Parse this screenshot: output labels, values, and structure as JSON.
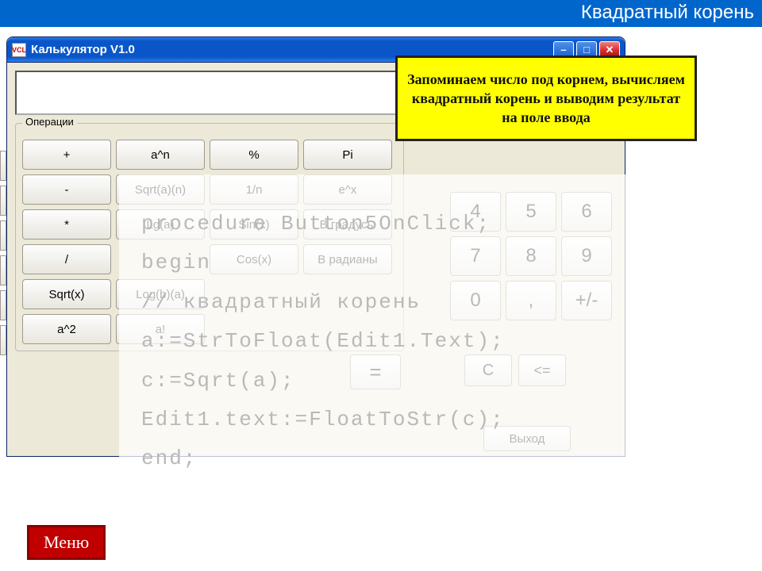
{
  "slide": {
    "header": "Квадратный корень",
    "menu_label": "Меню"
  },
  "callout": {
    "text": "Запоминаем число под корнем, вычисляем квадратный корень и выводим результат на поле ввода"
  },
  "window": {
    "title": "Калькулятор V1.0",
    "icon_text": "VCL",
    "ops_legend": "Операции",
    "ops": [
      [
        "+",
        "a^n",
        "%",
        "Pi"
      ],
      [
        "-",
        "Sqrt(a)(n)",
        "1/n",
        "e^x"
      ],
      [
        "*",
        "Lg(a)",
        "Sin(x)",
        "В градусы"
      ],
      [
        "/",
        "Cos(x)",
        "В радианы"
      ],
      [
        "Sqrt(x)",
        "Log(b)(a)"
      ],
      [
        "a^2",
        "a!"
      ]
    ],
    "numpad": [
      "4",
      "5",
      "6",
      "7",
      "8",
      "9",
      "0",
      ",",
      "+/-"
    ],
    "equals": "=",
    "clear": "C",
    "back": "<=",
    "exit": "Выход"
  },
  "code": {
    "line1": "procedure Button5OnClick;",
    "line2": "begin",
    "line3": "// квадратный корень",
    "line4": "a:=StrToFloat(Edit1.Text);",
    "line5": "c:=Sqrt(a);",
    "line6": "Edit1.text:=FloatToStr(c);",
    "line7": "end;"
  }
}
